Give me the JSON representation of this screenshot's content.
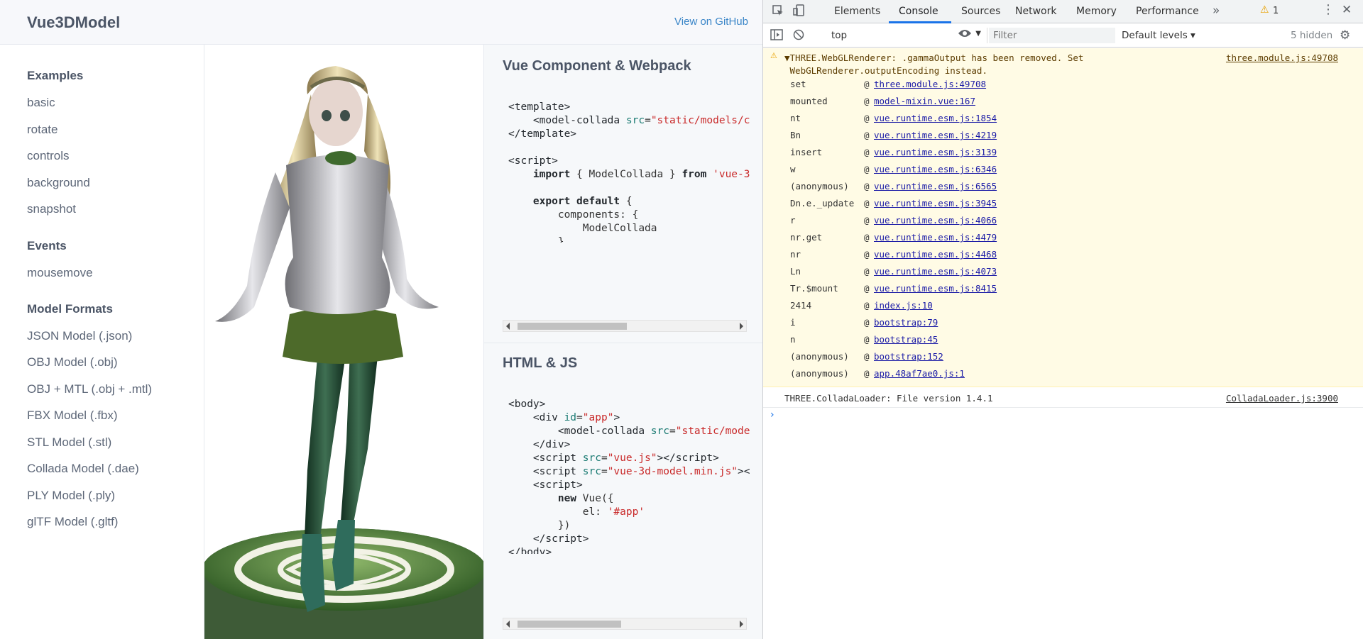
{
  "page": {
    "brand": "Vue3DModel",
    "github_link": "View on GitHub"
  },
  "sidebar": {
    "sections": [
      {
        "title": "Examples",
        "items": [
          "basic",
          "rotate",
          "controls",
          "background",
          "snapshot"
        ]
      },
      {
        "title": "Events",
        "items": [
          "mousemove"
        ]
      },
      {
        "title": "Model Formats",
        "items": [
          "JSON Model (.json)",
          "OBJ Model (.obj)",
          "OBJ + MTL (.obj + .mtl)",
          "FBX Model (.fbx)",
          "STL Model (.stl)",
          "Collada Model (.dae)",
          "PLY Model (.ply)",
          "glTF Model (.gltf)"
        ]
      }
    ]
  },
  "code": {
    "section1_title": "Vue Component & Webpack",
    "section2_title": "HTML & JS"
  },
  "devtools": {
    "tabs": [
      "Elements",
      "Console",
      "Sources",
      "Network",
      "Memory",
      "Performance"
    ],
    "active_tab": "Console",
    "warning_count": "1",
    "context": "top",
    "filter_placeholder": "Filter",
    "levels": "Default levels ▾",
    "hidden": "5 hidden",
    "warning": {
      "text": "▼THREE.WebGLRenderer: .gammaOutput has been removed. Set\n WebGLRenderer.outputEncoding instead.",
      "source": "three.module.js:49708",
      "stack": [
        {
          "fn": "set",
          "loc": "three.module.js:49708"
        },
        {
          "fn": "mounted",
          "loc": "model-mixin.vue:167"
        },
        {
          "fn": "nt",
          "loc": "vue.runtime.esm.js:1854"
        },
        {
          "fn": "Bn",
          "loc": "vue.runtime.esm.js:4219"
        },
        {
          "fn": "insert",
          "loc": "vue.runtime.esm.js:3139"
        },
        {
          "fn": "w",
          "loc": "vue.runtime.esm.js:6346"
        },
        {
          "fn": "(anonymous)",
          "loc": "vue.runtime.esm.js:6565"
        },
        {
          "fn": "Dn.e._update",
          "loc": "vue.runtime.esm.js:3945"
        },
        {
          "fn": "r",
          "loc": "vue.runtime.esm.js:4066"
        },
        {
          "fn": "nr.get",
          "loc": "vue.runtime.esm.js:4479"
        },
        {
          "fn": "nr",
          "loc": "vue.runtime.esm.js:4468"
        },
        {
          "fn": "Ln",
          "loc": "vue.runtime.esm.js:4073"
        },
        {
          "fn": "Tr.$mount",
          "loc": "vue.runtime.esm.js:8415"
        },
        {
          "fn": "2414",
          "loc": "index.js:10"
        },
        {
          "fn": "i",
          "loc": "bootstrap:79"
        },
        {
          "fn": "n",
          "loc": "bootstrap:45"
        },
        {
          "fn": "(anonymous)",
          "loc": "bootstrap:152"
        },
        {
          "fn": "(anonymous)",
          "loc": "app.48af7ae0.js:1"
        }
      ]
    },
    "info": {
      "text": "THREE.ColladaLoader: File version 1.4.1",
      "source": "ColladaLoader.js:3900"
    },
    "prompt": "›"
  }
}
